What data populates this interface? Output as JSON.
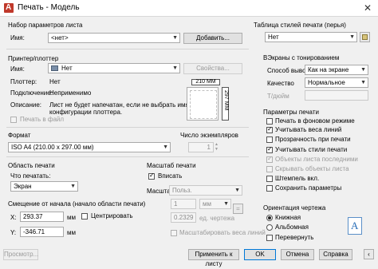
{
  "window": {
    "title": "Печать - Модель",
    "close": "✕"
  },
  "page_setup": {
    "group": "Набор параметров листа",
    "name_label": "Имя:",
    "name_value": "<нет>",
    "add_button": "Добавить..."
  },
  "printer": {
    "group": "Принтер/плоттер",
    "name_label": "Имя:",
    "name_value": "Нет",
    "properties_button": "Свойства...",
    "plotter_label": "Плоттер:",
    "plotter_value": "Нет",
    "location_label": "Подключение:",
    "location_value": "Неприменимо",
    "description_label": "Описание:",
    "description_line1": "Лист не будет напечатан, если не выбрать имя",
    "description_line2": "конфигурации плоттера.",
    "print_to_file": "Печать в файл",
    "preview_width": "210 ММ",
    "preview_height": "297 ММ"
  },
  "paper": {
    "group": "Формат",
    "value": "ISO A4 (210.00 x 297.00 мм)",
    "copies_label": "Число экземпляров",
    "copies_value": "1"
  },
  "plot_area": {
    "group": "Область печати",
    "what_label": "Что печатать:",
    "what_value": "Экран"
  },
  "offset": {
    "group": "Смещение от начала (начало области печати)",
    "x_label": "X:",
    "x_value": "293.37",
    "x_unit": "мм",
    "y_label": "Y:",
    "y_value": "-346.71",
    "y_unit": "мм",
    "center": "Центрировать"
  },
  "scale": {
    "group": "Масштаб печати",
    "fit": "Вписать",
    "scale_label": "Масштаб:",
    "scale_value": "Польз.",
    "value1": "1",
    "unit1": "мм",
    "value2": "0.2329",
    "unit2": "ед. чертежа",
    "lineweights": "Масштабировать веса линий"
  },
  "style_table": {
    "group": "Таблица стилей печати (перья)",
    "value": "Нет"
  },
  "shaded": {
    "group": "ВЭкраны с тонированием",
    "output_label": "Способ вывода",
    "output_value": "Как на экране",
    "quality_label": "Качество",
    "quality_value": "Нормальное",
    "dpi_label": "Т/дюйм"
  },
  "options": {
    "group": "Параметры печати",
    "items": [
      {
        "label": "Печать в фоновом режиме",
        "checked": false,
        "disabled": false
      },
      {
        "label": "Учитывать веса линий",
        "checked": true,
        "disabled": false
      },
      {
        "label": "Прозрачность при печати",
        "checked": false,
        "disabled": false
      },
      {
        "label": "Учитывать стили печати",
        "checked": true,
        "disabled": false
      },
      {
        "label": "Объекты листа последними",
        "checked": true,
        "disabled": true
      },
      {
        "label": "Скрывать объекты листа",
        "checked": false,
        "disabled": true
      },
      {
        "label": "Штемпель вкл.",
        "checked": false,
        "disabled": false
      },
      {
        "label": "Сохранить параметры",
        "checked": false,
        "disabled": false
      }
    ]
  },
  "orientation": {
    "group": "Ориентация чертежа",
    "portrait": "Книжная",
    "landscape": "Альбомная",
    "upside_down": "Перевернуть",
    "icon_letter": "A"
  },
  "footer": {
    "preview": "Просмотр...",
    "apply": "Применить к листу",
    "ok": "OK",
    "cancel": "Отмена",
    "help": "Справка"
  }
}
